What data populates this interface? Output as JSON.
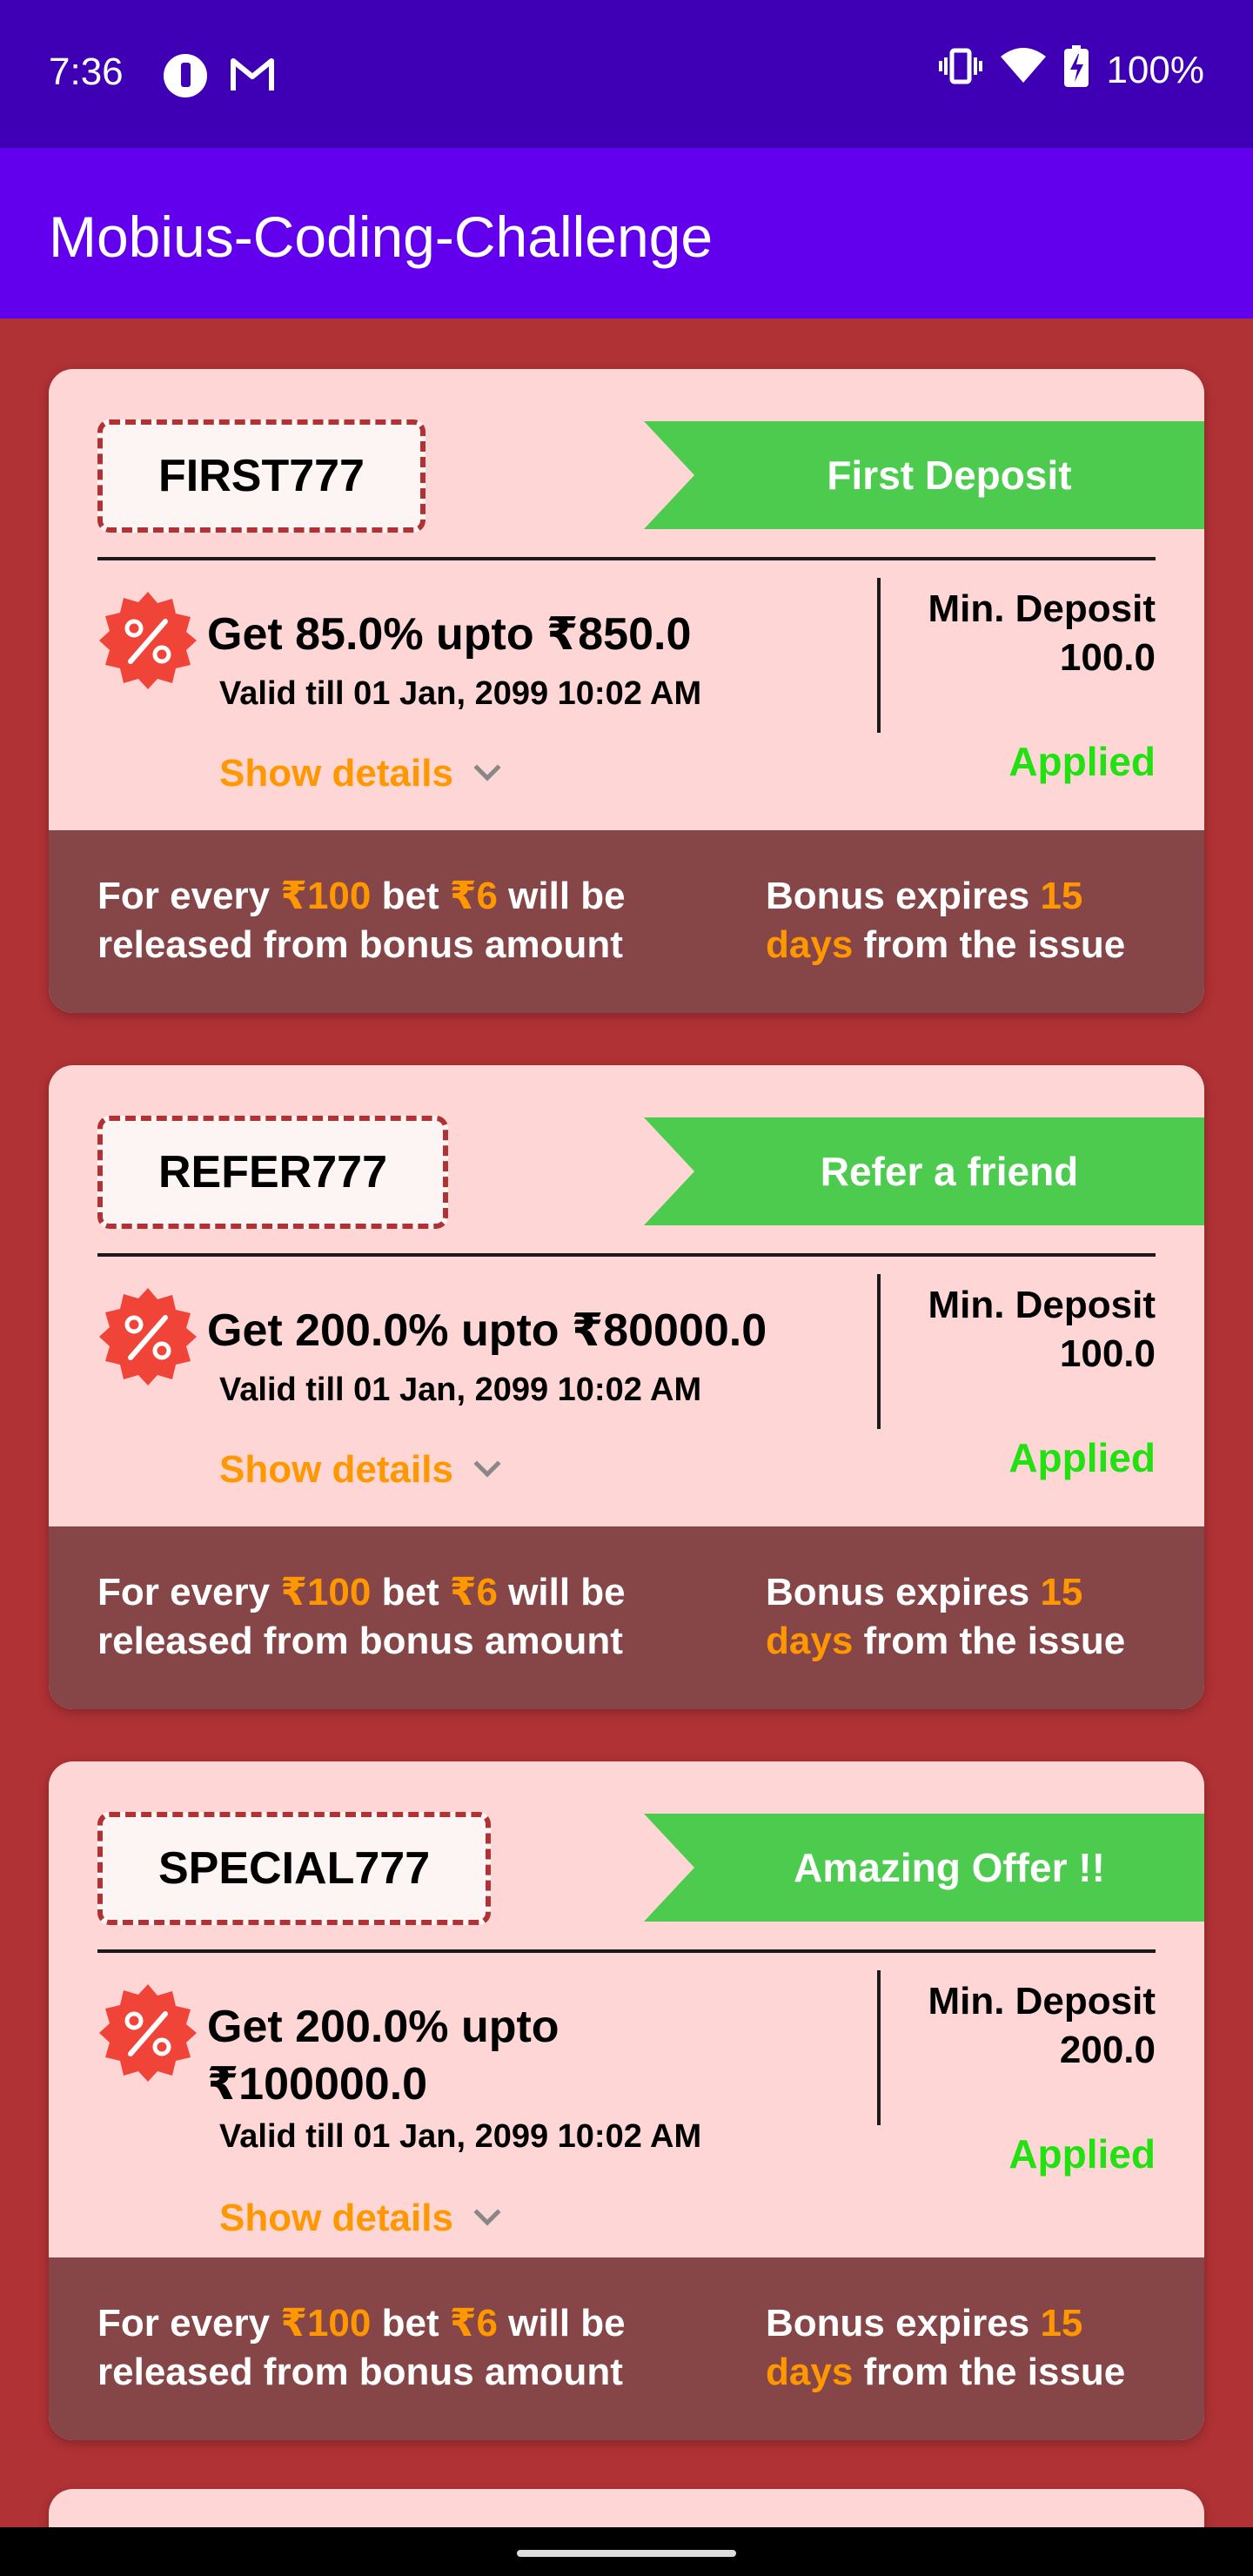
{
  "status_bar": {
    "time": "7:36",
    "battery": "100%",
    "icons": [
      "app-r-icon",
      "gmail-icon",
      "vibrate-icon",
      "wifi-icon",
      "battery-charging-icon"
    ]
  },
  "app_bar": {
    "title": "Mobius-Coding-Challenge"
  },
  "colors": {
    "status_bar": "#3f00b5",
    "app_bar": "#6200ee",
    "background": "#b03235",
    "card": "#fed6d6",
    "card_footer": "#864546",
    "ribbon": "#4ccb4e",
    "accent_orange": "#ff9800",
    "applied_green": "#22e011"
  },
  "common": {
    "show_details": "Show details",
    "min_deposit_label": "Min. Deposit",
    "applied": "Applied",
    "rule_prefix": "For every",
    "rule_bet_amount": "₹100",
    "rule_mid": "bet",
    "rule_release_amount": "₹6",
    "rule_suffix": "will be released from bonus amount",
    "expiry_prefix": "Bonus expires",
    "expiry_value": "15 days",
    "expiry_suffix": "from the issue"
  },
  "coupons": [
    {
      "code": "FIRST777",
      "tag": "First Deposit",
      "offer": "Get 85.0% upto ₹850.0",
      "valid": "Valid till 01 Jan, 2099 10:02 AM",
      "min_deposit": "100.0"
    },
    {
      "code": "REFER777",
      "tag": "Refer a friend",
      "offer": "Get 200.0% upto ₹80000.0",
      "valid": "Valid till 01 Jan, 2099 10:02 AM",
      "min_deposit": "100.0"
    },
    {
      "code": "SPECIAL777",
      "tag": "Amazing Offer !!",
      "offer": "Get 200.0% upto ₹100000.0",
      "valid": "Valid till 01 Jan, 2099 10:02 AM",
      "min_deposit": "200.0"
    }
  ]
}
